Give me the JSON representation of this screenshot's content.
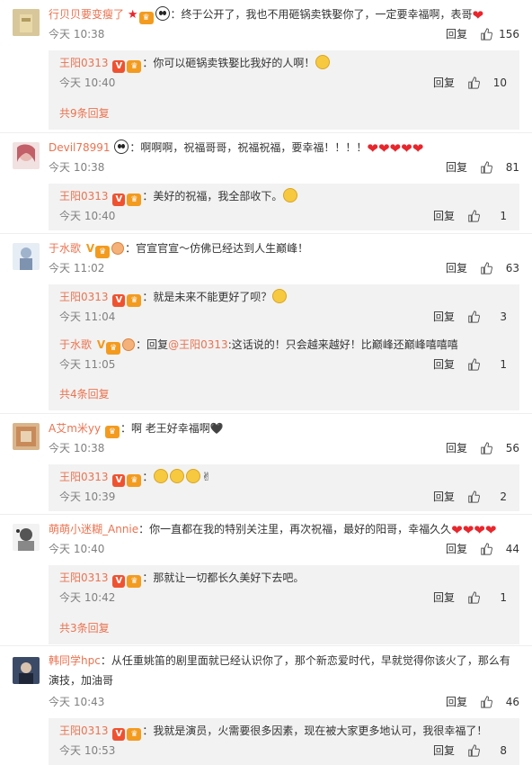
{
  "ui": {
    "reply_label": "回复"
  },
  "comments": [
    {
      "user": "行贝贝要变瘦了",
      "text": "：终于公开了，我也不用砸锅卖铁娶你了，一定要幸福啊，表哥",
      "time": "今天 10:38",
      "likes": "156",
      "avatar_color": "#c9b58a",
      "replies": [
        {
          "user": "王阳0313",
          "text": "：你可以砸锅卖铁娶比我好的人啊！",
          "time": "今天 10:40",
          "likes": "10"
        }
      ],
      "more": "共9条回复"
    },
    {
      "user": "Devil78991",
      "text": "：啊啊啊，祝福哥哥，祝福祝福，要幸福！！！！",
      "time": "今天 10:38",
      "likes": "81",
      "avatar_color": "#d7a6a6",
      "replies": [
        {
          "user": "王阳0313",
          "text": "：美好的祝福，我全部收下。",
          "time": "今天 10:40",
          "likes": "1"
        }
      ]
    },
    {
      "user": "于水歌",
      "text": "：官宣官宣～仿佛已经达到人生巅峰！",
      "time": "今天 11:02",
      "likes": "63",
      "avatar_color": "#b8c7d9",
      "replies": [
        {
          "user": "王阳0313",
          "text": "：就是未来不能更好了呗？",
          "time": "今天 11:04",
          "likes": "3"
        },
        {
          "user": "于水歌",
          "reply_prefix": "：回复",
          "mention": "@王阳0313",
          "text": ":这话说的！只会越来越好！比巅峰还巅峰嘻嘻嘻",
          "time": "今天 11:05",
          "likes": "1"
        }
      ],
      "more": "共4条回复"
    },
    {
      "user": "A艾m米yy",
      "text": "：啊 老王好幸福啊🖤",
      "time": "今天 10:38",
      "likes": "56",
      "avatar_color": "#c98a5a",
      "replies": [
        {
          "user": "王阳0313",
          "text": "：",
          "time": "今天 10:39",
          "likes": "2"
        }
      ]
    },
    {
      "user": "萌萌小迷糊_Annie",
      "text": "：你一直都在我的特别关注里，再次祝福，最好的阳哥，幸福久久",
      "time": "今天 10:40",
      "likes": "44",
      "avatar_color": "#8a8a8a",
      "replies": [
        {
          "user": "王阳0313",
          "text": "：那就让一切都长久美好下去吧。",
          "time": "今天 10:42",
          "likes": "1"
        }
      ],
      "more": "共3条回复"
    },
    {
      "user": "韩同学hpc",
      "text": "：从任重姚笛的剧里面就已经认识你了，那个新恋爱时代，早就觉得你该火了，那么有演技，加油哥",
      "time": "今天 10:43",
      "likes": "46",
      "avatar_color": "#4a5a7a",
      "replies": [
        {
          "user": "王阳0313",
          "text": "：我就是演员，火需要很多因素，现在被大家更多地认可，我很幸福了！",
          "time": "今天 10:53",
          "likes": "8"
        }
      ]
    }
  ]
}
